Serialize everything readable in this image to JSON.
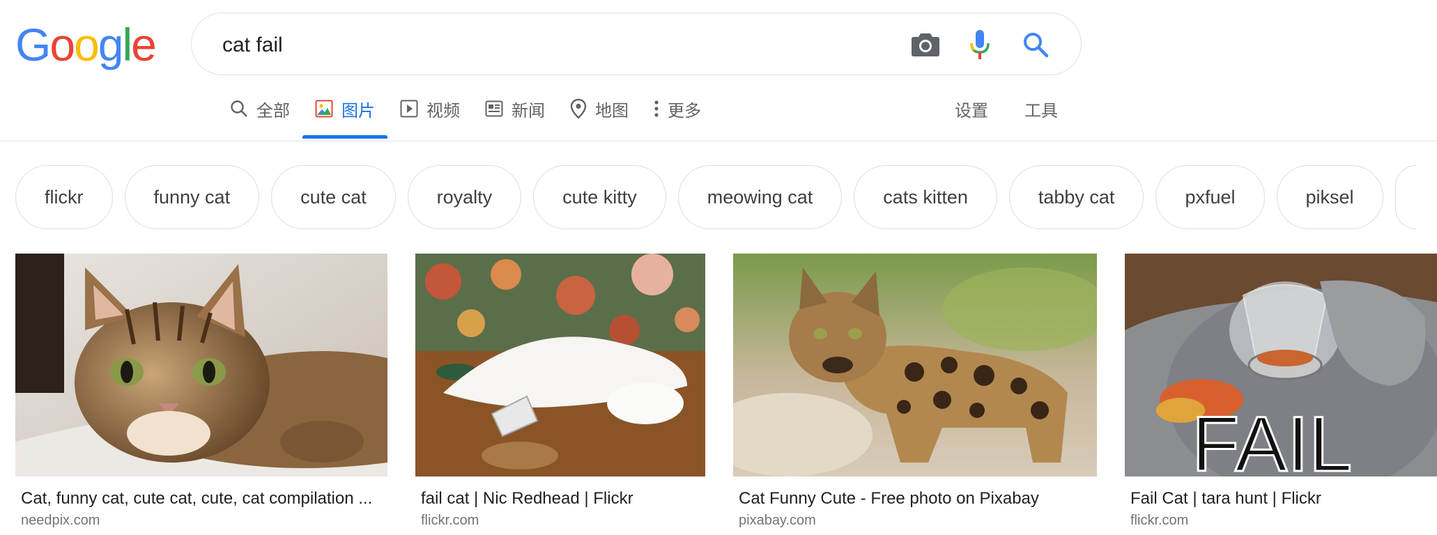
{
  "logo": {
    "letters": [
      "G",
      "o",
      "o",
      "g",
      "l",
      "e"
    ],
    "colors": [
      "#4285f4",
      "#ea4335",
      "#fbbc05",
      "#4285f4",
      "#34a853",
      "#ea4335"
    ]
  },
  "search": {
    "query": "cat fail",
    "icons": [
      "camera-icon",
      "microphone-icon",
      "search-icon"
    ]
  },
  "tabs": [
    {
      "label": "全部",
      "icon": "search-icon",
      "active": false
    },
    {
      "label": "图片",
      "icon": "image-icon",
      "active": true
    },
    {
      "label": "视频",
      "icon": "play-icon",
      "active": false
    },
    {
      "label": "新闻",
      "icon": "news-icon",
      "active": false
    },
    {
      "label": "地图",
      "icon": "map-pin-icon",
      "active": false
    },
    {
      "label": "更多",
      "icon": "more-vert-icon",
      "active": false
    }
  ],
  "tools": {
    "settings": "设置",
    "tools": "工具"
  },
  "chips": [
    "flickr",
    "funny cat",
    "cute cat",
    "royalty",
    "cute kitty",
    "meowing cat",
    "cats kitten",
    "tabby cat",
    "pxfuel",
    "piksel"
  ],
  "results": [
    {
      "title": "Cat, funny cat, cute cat, cute, cat compilation ...",
      "source": "needpix.com"
    },
    {
      "title": "fail cat | Nic Redhead | Flickr",
      "source": "flickr.com"
    },
    {
      "title": "Cat Funny Cute - Free photo on Pixabay",
      "source": "pixabay.com"
    },
    {
      "title": "Fail Cat | tara hunt | Flickr",
      "source": "flickr.com"
    }
  ],
  "image_text": {
    "fail_caption": "FAIL"
  },
  "colors": {
    "accent": "#1a73e8",
    "border": "#dfe1e5",
    "text_secondary": "#5f6368"
  }
}
